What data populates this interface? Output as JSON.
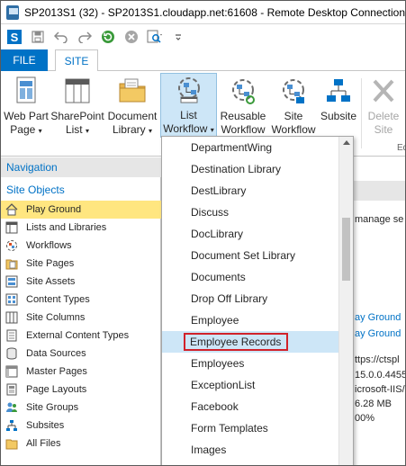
{
  "window": {
    "title": "SP2013S1 (32) - SP2013S1.cloudapp.net:61608 - Remote Desktop Connection"
  },
  "tabs": {
    "file": "FILE",
    "site": "SITE"
  },
  "ribbon": {
    "web_part_page": {
      "line1": "Web Part",
      "line2": "Page"
    },
    "sharepoint_list": {
      "line1": "SharePoint",
      "line2": "List"
    },
    "document_library": {
      "line1": "Document",
      "line2": "Library"
    },
    "list_workflow": {
      "line1": "List",
      "line2": "Workflow"
    },
    "reusable_workflow": {
      "line1": "Reusable",
      "line2": "Workflow"
    },
    "site_workflow": {
      "line1": "Site",
      "line2": "Workflow"
    },
    "subsite": {
      "line1": "Subsite"
    },
    "delete_site": {
      "line1": "Delete",
      "line2": "Site"
    },
    "edge_label": "Ed",
    "caret": "▾"
  },
  "navigation": {
    "header": "Navigation",
    "subheader": "Site Objects",
    "items": [
      {
        "label": "Play Ground",
        "icon": "home-icon",
        "selected": true
      },
      {
        "label": "Lists and Libraries",
        "icon": "list-icon"
      },
      {
        "label": "Workflows",
        "icon": "workflow-icon"
      },
      {
        "label": "Site Pages",
        "icon": "pages-icon"
      },
      {
        "label": "Site Assets",
        "icon": "assets-icon"
      },
      {
        "label": "Content Types",
        "icon": "content-types-icon"
      },
      {
        "label": "Site Columns",
        "icon": "columns-icon"
      },
      {
        "label": "External Content Types",
        "icon": "external-content-icon"
      },
      {
        "label": "Data Sources",
        "icon": "database-icon"
      },
      {
        "label": "Master Pages",
        "icon": "master-pages-icon"
      },
      {
        "label": "Page Layouts",
        "icon": "page-layouts-icon"
      },
      {
        "label": "Site Groups",
        "icon": "groups-icon"
      },
      {
        "label": "Subsites",
        "icon": "subsites-icon"
      },
      {
        "label": "All Files",
        "icon": "folder-icon"
      }
    ]
  },
  "content_fragments": {
    "manage": "manage se",
    "play_ground_1": "ay Ground",
    "play_ground_2": "ay Ground",
    "url": "ttps://ctspl",
    "version": "15.0.0.4455",
    "server": "icrosoft-IIS/",
    "size": "6.28 MB",
    "percent": "00%"
  },
  "dropdown": {
    "items": [
      "DepartmentWing",
      "Destination Library",
      "DestLibrary",
      "Discuss",
      "DocLibrary",
      "Document Set Library",
      "Documents",
      "Drop Off Library",
      "Employee",
      "Employee Records",
      "Employees",
      "ExceptionList",
      "Facebook",
      "Form Templates",
      "Images"
    ],
    "highlighted": "Employee Records"
  },
  "colors": {
    "accent": "#0072c6",
    "selected_nav": "#ffe680",
    "highlight": "#cde6f7",
    "callout_border": "#d1222a"
  }
}
